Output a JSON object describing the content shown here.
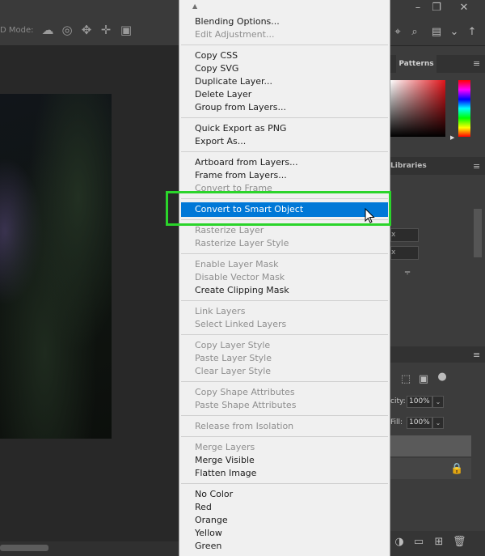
{
  "optionbar": {
    "mode_label": "D Mode:",
    "icons": [
      "rotate-3d-icon",
      "roll-3d-icon",
      "drag-3d-icon",
      "slide-3d-icon",
      "video-camera-icon"
    ]
  },
  "panels": {
    "patterns_tab": "Patterns",
    "libraries_tab": "Libraries",
    "opacity_label": "city:",
    "opacity_value": "100%",
    "fill_label": "Fill:",
    "fill_value": "100%",
    "field_1": "x",
    "field_2": "x"
  },
  "context_menu": {
    "groups": [
      [
        {
          "label": "Blending Options...",
          "enabled": true
        },
        {
          "label": "Edit Adjustment...",
          "enabled": false
        }
      ],
      [
        {
          "label": "Copy CSS",
          "enabled": true
        },
        {
          "label": "Copy SVG",
          "enabled": true
        },
        {
          "label": "Duplicate Layer...",
          "enabled": true
        },
        {
          "label": "Delete Layer",
          "enabled": true
        },
        {
          "label": "Group from Layers...",
          "enabled": true
        }
      ],
      [
        {
          "label": "Quick Export as PNG",
          "enabled": true
        },
        {
          "label": "Export As...",
          "enabled": true
        }
      ],
      [
        {
          "label": "Artboard from Layers...",
          "enabled": true
        },
        {
          "label": "Frame from Layers...",
          "enabled": true
        },
        {
          "label": "Convert to Frame",
          "enabled": false
        }
      ],
      [
        {
          "label": "Convert to Smart Object",
          "enabled": true,
          "highlighted": true
        }
      ],
      [
        {
          "label": "Rasterize Layer",
          "enabled": false
        },
        {
          "label": "Rasterize Layer Style",
          "enabled": false
        }
      ],
      [
        {
          "label": "Enable Layer Mask",
          "enabled": false
        },
        {
          "label": "Disable Vector Mask",
          "enabled": false
        },
        {
          "label": "Create Clipping Mask",
          "enabled": true
        }
      ],
      [
        {
          "label": "Link Layers",
          "enabled": false
        },
        {
          "label": "Select Linked Layers",
          "enabled": false
        }
      ],
      [
        {
          "label": "Copy Layer Style",
          "enabled": false
        },
        {
          "label": "Paste Layer Style",
          "enabled": false
        },
        {
          "label": "Clear Layer Style",
          "enabled": false
        }
      ],
      [
        {
          "label": "Copy Shape Attributes",
          "enabled": false
        },
        {
          "label": "Paste Shape Attributes",
          "enabled": false
        }
      ],
      [
        {
          "label": "Release from Isolation",
          "enabled": false
        }
      ],
      [
        {
          "label": "Merge Layers",
          "enabled": false
        },
        {
          "label": "Merge Visible",
          "enabled": true
        },
        {
          "label": "Flatten Image",
          "enabled": true
        }
      ],
      [
        {
          "label": "No Color",
          "enabled": true
        },
        {
          "label": "Red",
          "enabled": true
        },
        {
          "label": "Orange",
          "enabled": true
        },
        {
          "label": "Yellow",
          "enabled": true
        },
        {
          "label": "Green",
          "enabled": true
        }
      ]
    ]
  },
  "colors": {
    "highlight": "#0078d7",
    "annotation_box": "#2bd42b",
    "menu_bg": "#f0f0f0"
  }
}
